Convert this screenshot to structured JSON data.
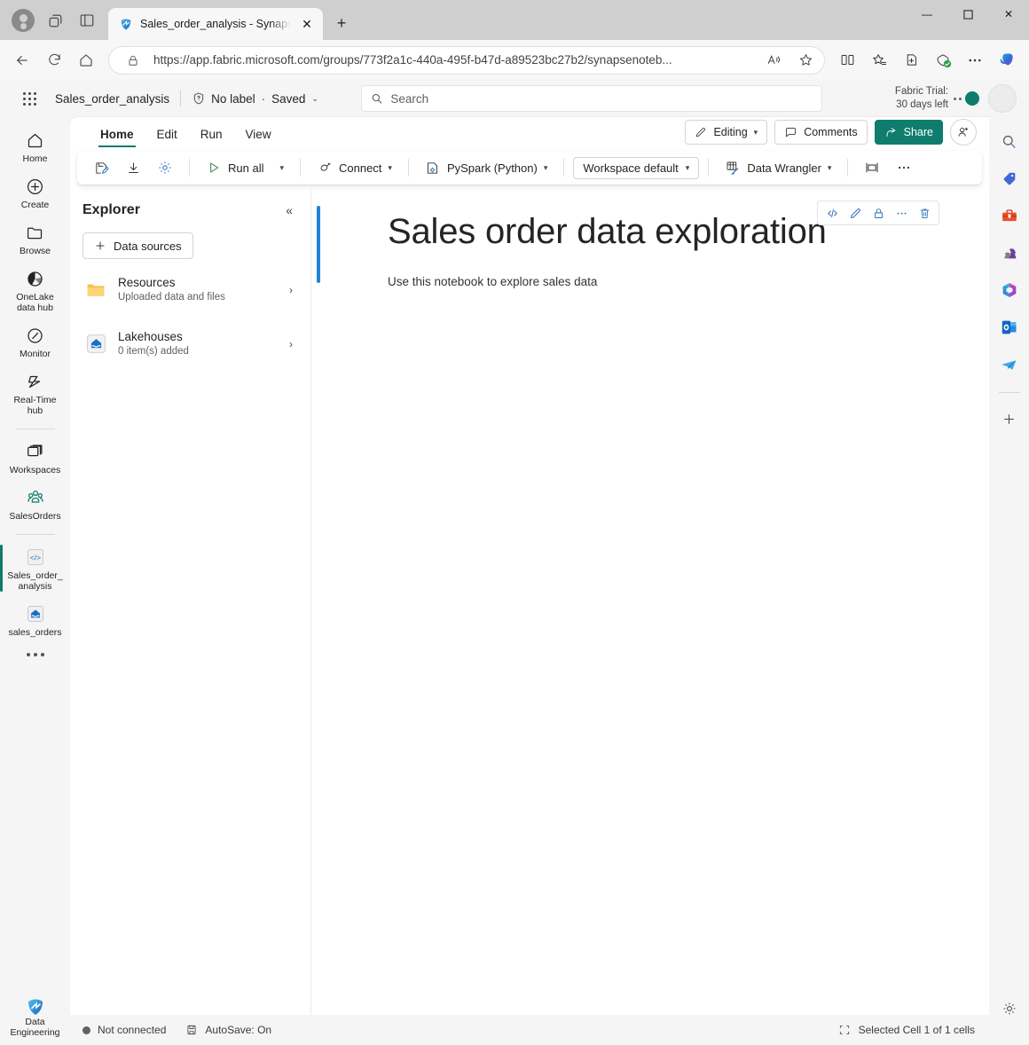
{
  "browser": {
    "tab": {
      "title": "Sales_order_analysis - Synapse D",
      "favicon": "fabric-favicon",
      "close_label": "✕"
    },
    "new_tab_label": "+",
    "toolbar_icons": [
      "profile-icon",
      "workspaces-icon",
      "tab-actions-icon"
    ],
    "nav": {
      "back": "←",
      "refresh": "⟳",
      "home": "home-icon"
    },
    "url": "https://app.fabric.microsoft.com/groups/773f2a1c-440a-495f-b47d-a89523bc27b2/synapsenoteb...",
    "url_prefix": "https://",
    "url_rest": "app.fabric.microsoft.com/groups/773f2a1c-440a-495f-b47d-a89523bc27b2/synapsenoteb...",
    "omni_icons": [
      "lock-icon",
      "read-aloud-icon",
      "favorite-star-icon"
    ],
    "ext_icons": [
      "split-screen-icon",
      "collections-icon",
      "browser-essentials-icon",
      "shield-check-icon",
      "more-icon",
      "copilot-icon"
    ],
    "window_controls": {
      "minimize": "—",
      "maximize": "☐",
      "close": "✕"
    }
  },
  "header": {
    "waffle": "app-launcher-icon",
    "title": "Sales_order_analysis",
    "sensitivity_icon": "shield-question-icon",
    "sensitivity_label": "No label",
    "separator_dot": "·",
    "saved_label": "Saved",
    "chevron": "⌄",
    "search_placeholder": "Search",
    "search_value": "",
    "search_icon": "search-icon",
    "trial_line1": "Fabric Trial:",
    "trial_line2": "30 days left",
    "status_dot_color": "#0f7b6c",
    "avatar": "user-avatar"
  },
  "rail": {
    "items": [
      {
        "label": "Home",
        "icon": "home-icon",
        "active": false
      },
      {
        "label": "Create",
        "icon": "plus-circle-icon",
        "active": false
      },
      {
        "label": "Browse",
        "icon": "folder-icon",
        "active": false
      },
      {
        "label": "OneLake data hub",
        "icon": "onelake-icon",
        "active": false
      },
      {
        "label": "Monitor",
        "icon": "monitor-icon",
        "active": false
      },
      {
        "label": "Real-Time hub",
        "icon": "realtime-hub-icon",
        "active": false
      },
      {
        "label": "Workspaces",
        "icon": "workspaces-icon",
        "active": false
      },
      {
        "label": "SalesOrders",
        "icon": "people-group-icon",
        "active": false
      },
      {
        "label": "Sales_order_analysis",
        "icon": "notebook-code-icon",
        "active": true
      },
      {
        "label": "sales_orders",
        "icon": "lakehouse-icon",
        "active": false
      }
    ],
    "more": "more-icon",
    "bottom": {
      "label": "Data Engineering",
      "icon": "data-engineering-icon"
    }
  },
  "ribbon": {
    "tabs": [
      {
        "label": "Home",
        "active": true
      },
      {
        "label": "Edit",
        "active": false
      },
      {
        "label": "Run",
        "active": false
      },
      {
        "label": "View",
        "active": false
      }
    ],
    "editing_label": "Editing",
    "editing_icon": "pencil-icon",
    "comments_label": "Comments",
    "comments_icon": "comment-icon",
    "share_label": "Share",
    "share_icon": "share-icon",
    "share_color": "#107c6e",
    "people_icon": "person-add-icon"
  },
  "toolbar": {
    "items": [
      {
        "name": "save-icon",
        "label": "",
        "type": "icon"
      },
      {
        "name": "download-icon",
        "label": "",
        "type": "icon"
      },
      {
        "name": "settings-gear-icon",
        "label": "",
        "type": "icon"
      },
      {
        "name": "run-all-button",
        "label": "Run all",
        "type": "button",
        "icon": "play-icon",
        "chevron": "⌄"
      },
      {
        "name": "connect-button",
        "label": "Connect",
        "type": "button",
        "icon": "connect-icon",
        "chevron": "⌄"
      },
      {
        "name": "language-button",
        "label": "PySpark (Python)",
        "type": "button",
        "icon": "language-icon",
        "chevron": "⌄"
      },
      {
        "name": "environment-select",
        "label": "Workspace default",
        "type": "box",
        "chevron": "⌄"
      },
      {
        "name": "data-wrangler-button",
        "label": "Data Wrangler",
        "type": "button",
        "icon": "wrangler-icon",
        "chevron": "⌄"
      },
      {
        "name": "layout-icon",
        "label": "",
        "type": "icon"
      },
      {
        "name": "overflow-icon",
        "label": "⋯",
        "type": "icon"
      }
    ]
  },
  "explorer": {
    "title": "Explorer",
    "collapse_icon": "«",
    "data_sources_label": "Data sources",
    "data_sources_plus": "+",
    "items": [
      {
        "name": "Resources",
        "subtitle": "Uploaded data and files",
        "icon": "folder-yellow-icon",
        "arrow": "›"
      },
      {
        "name": "Lakehouses",
        "subtitle": "0 item(s) added",
        "icon": "lakehouse-icon",
        "arrow": "›"
      }
    ]
  },
  "notebook": {
    "cell_accent": "#1f84d6",
    "heading": "Sales order data exploration",
    "paragraph": "Use this notebook to explore sales data",
    "cell_tools": [
      {
        "name": "convert-to-code-icon",
        "glyph": "</>"
      },
      {
        "name": "edit-icon",
        "glyph": "pencil"
      },
      {
        "name": "lock-icon",
        "glyph": "lock"
      },
      {
        "name": "more-icon",
        "glyph": "⋯"
      },
      {
        "name": "delete-icon",
        "glyph": "trash"
      }
    ]
  },
  "right_rail": {
    "icons": [
      "search-icon",
      "tag-icon",
      "toolbox-icon",
      "chess-icon",
      "microsoft365-icon",
      "outlook-icon",
      "telegram-icon"
    ],
    "add_label": "+",
    "settings_icon": "gear-icon"
  },
  "statusbar": {
    "connection": "Not connected",
    "connection_icon": "status-dot",
    "autosave": "AutoSave: On",
    "autosave_icon": "save-icon",
    "selection_icon": "cell-selection-icon",
    "selection": "Selected Cell 1 of 1 cells"
  }
}
